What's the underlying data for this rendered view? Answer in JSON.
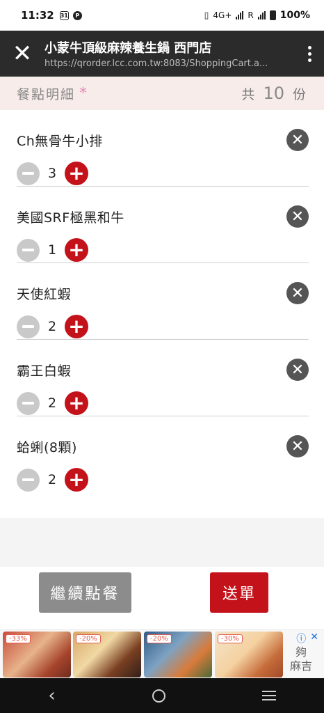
{
  "status_bar": {
    "time": "11:32",
    "notif_icons": [
      "31",
      "P"
    ],
    "network": "4G+",
    "roaming": "R",
    "battery": "100%"
  },
  "browser": {
    "title": "小蒙牛頂級麻辣養生鍋 西門店",
    "url": "https://qrorder.lcc.com.tw:8083/ShoppingCart.a..."
  },
  "order": {
    "label": "餐點明細",
    "required_mark": "*",
    "total_prefix": "共",
    "total_count": "10",
    "total_unit": "份"
  },
  "items": [
    {
      "name": "Ch無骨牛小排",
      "qty": "3"
    },
    {
      "name": "美國SRF極黑和牛",
      "qty": "1"
    },
    {
      "name": "天使紅蝦",
      "qty": "2"
    },
    {
      "name": "霸王白蝦",
      "qty": "2"
    },
    {
      "name": "蛤蜊(8顆)",
      "qty": "2"
    }
  ],
  "actions": {
    "continue_label": "繼續點餐",
    "submit_label": "送單"
  },
  "ad": {
    "discounts": [
      "-33%",
      "-20%",
      "-20%",
      "-30%"
    ],
    "brand_line1": "夠",
    "brand_line2": "麻吉"
  },
  "colors": {
    "accent_red": "#c4121b",
    "header_bg": "#2b2b2b",
    "order_head_bg": "#f7ecea",
    "star_pink": "#e889b6"
  }
}
